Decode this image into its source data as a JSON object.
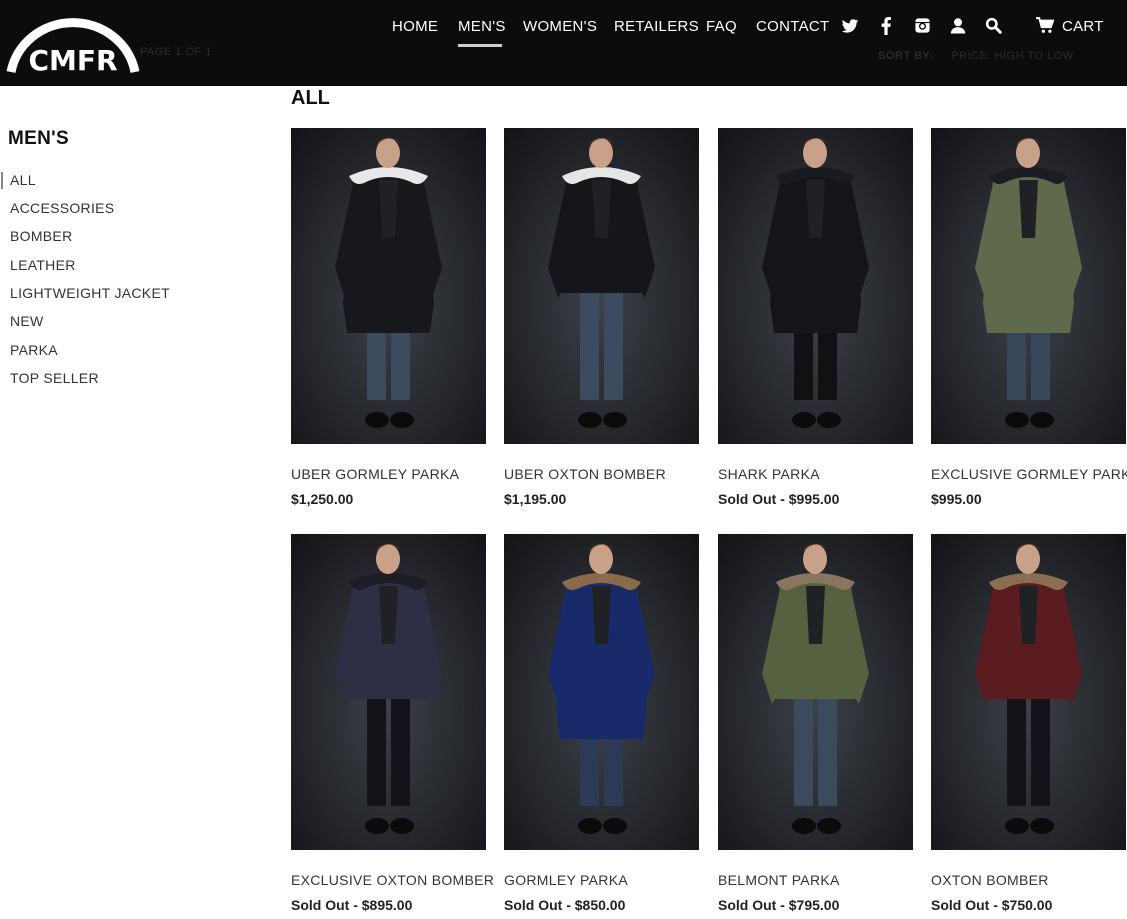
{
  "brand": {
    "logo_text": "CMFR"
  },
  "header": {
    "page_info": "PAGE 1 OF 1",
    "sort_label": "SORT BY:",
    "sort_value": "PRICE: HIGH TO LOW",
    "nav": [
      "HOME",
      "MEN'S",
      "WOMEN'S",
      "RETAILERS",
      "FAQ",
      "CONTACT"
    ],
    "active_nav": "MEN'S",
    "cart_label": "CART",
    "icons": [
      "twitter-icon",
      "facebook-icon",
      "instagram-icon",
      "account-icon",
      "search-icon",
      "cart-icon"
    ]
  },
  "sidebar": {
    "title": "MEN'S",
    "items": [
      "ALL",
      "ACCESSORIES",
      "BOMBER",
      "LEATHER",
      "LIGHTWEIGHT JACKET",
      "NEW",
      "PARKA",
      "TOP SELLER"
    ],
    "active": "ALL"
  },
  "main": {
    "title": "ALL",
    "products": [
      {
        "name": "UBER GORMLEY PARKA",
        "price": "$1,250.00",
        "jacket_color": "#16181c",
        "pants_color": "#3c4a5e",
        "hood": "#e8e8e8",
        "long": true
      },
      {
        "name": "UBER OXTON BOMBER",
        "price": "$1,195.00",
        "jacket_color": "#15161a",
        "pants_color": "#3d4b5e",
        "hood": "#e6e6e6",
        "long": false
      },
      {
        "name": "SHARK PARKA",
        "price": "Sold Out - $995.00",
        "jacket_color": "#141518",
        "pants_color": "#111114",
        "hood": "#1a1b1e",
        "long": true
      },
      {
        "name": "EXCLUSIVE GORMLEY PARKA",
        "price": "$995.00",
        "jacket_color": "#5f6a4c",
        "pants_color": "#3a475a",
        "hood": "#1c1d22",
        "long": true
      },
      {
        "name": "EXCLUSIVE OXTON BOMBER",
        "price": "Sold Out - $895.00",
        "jacket_color": "#2d2f45",
        "pants_color": "#141418",
        "hood": "#1c1d26",
        "long": false
      },
      {
        "name": "GORMLEY PARKA",
        "price": "Sold Out - $850.00",
        "jacket_color": "#182a6a",
        "pants_color": "#2d3a55",
        "hood": "#8b6a4a",
        "long": true
      },
      {
        "name": "BELMONT PARKA",
        "price": "Sold Out - $795.00",
        "jacket_color": "#56613f",
        "pants_color": "#3b4a5c",
        "hood": "#8a7660",
        "long": false
      },
      {
        "name": "OXTON BOMBER",
        "price": "Sold Out - $750.00",
        "jacket_color": "#5a1c20",
        "pants_color": "#141418",
        "hood": "#8b6d52",
        "long": false
      }
    ]
  }
}
